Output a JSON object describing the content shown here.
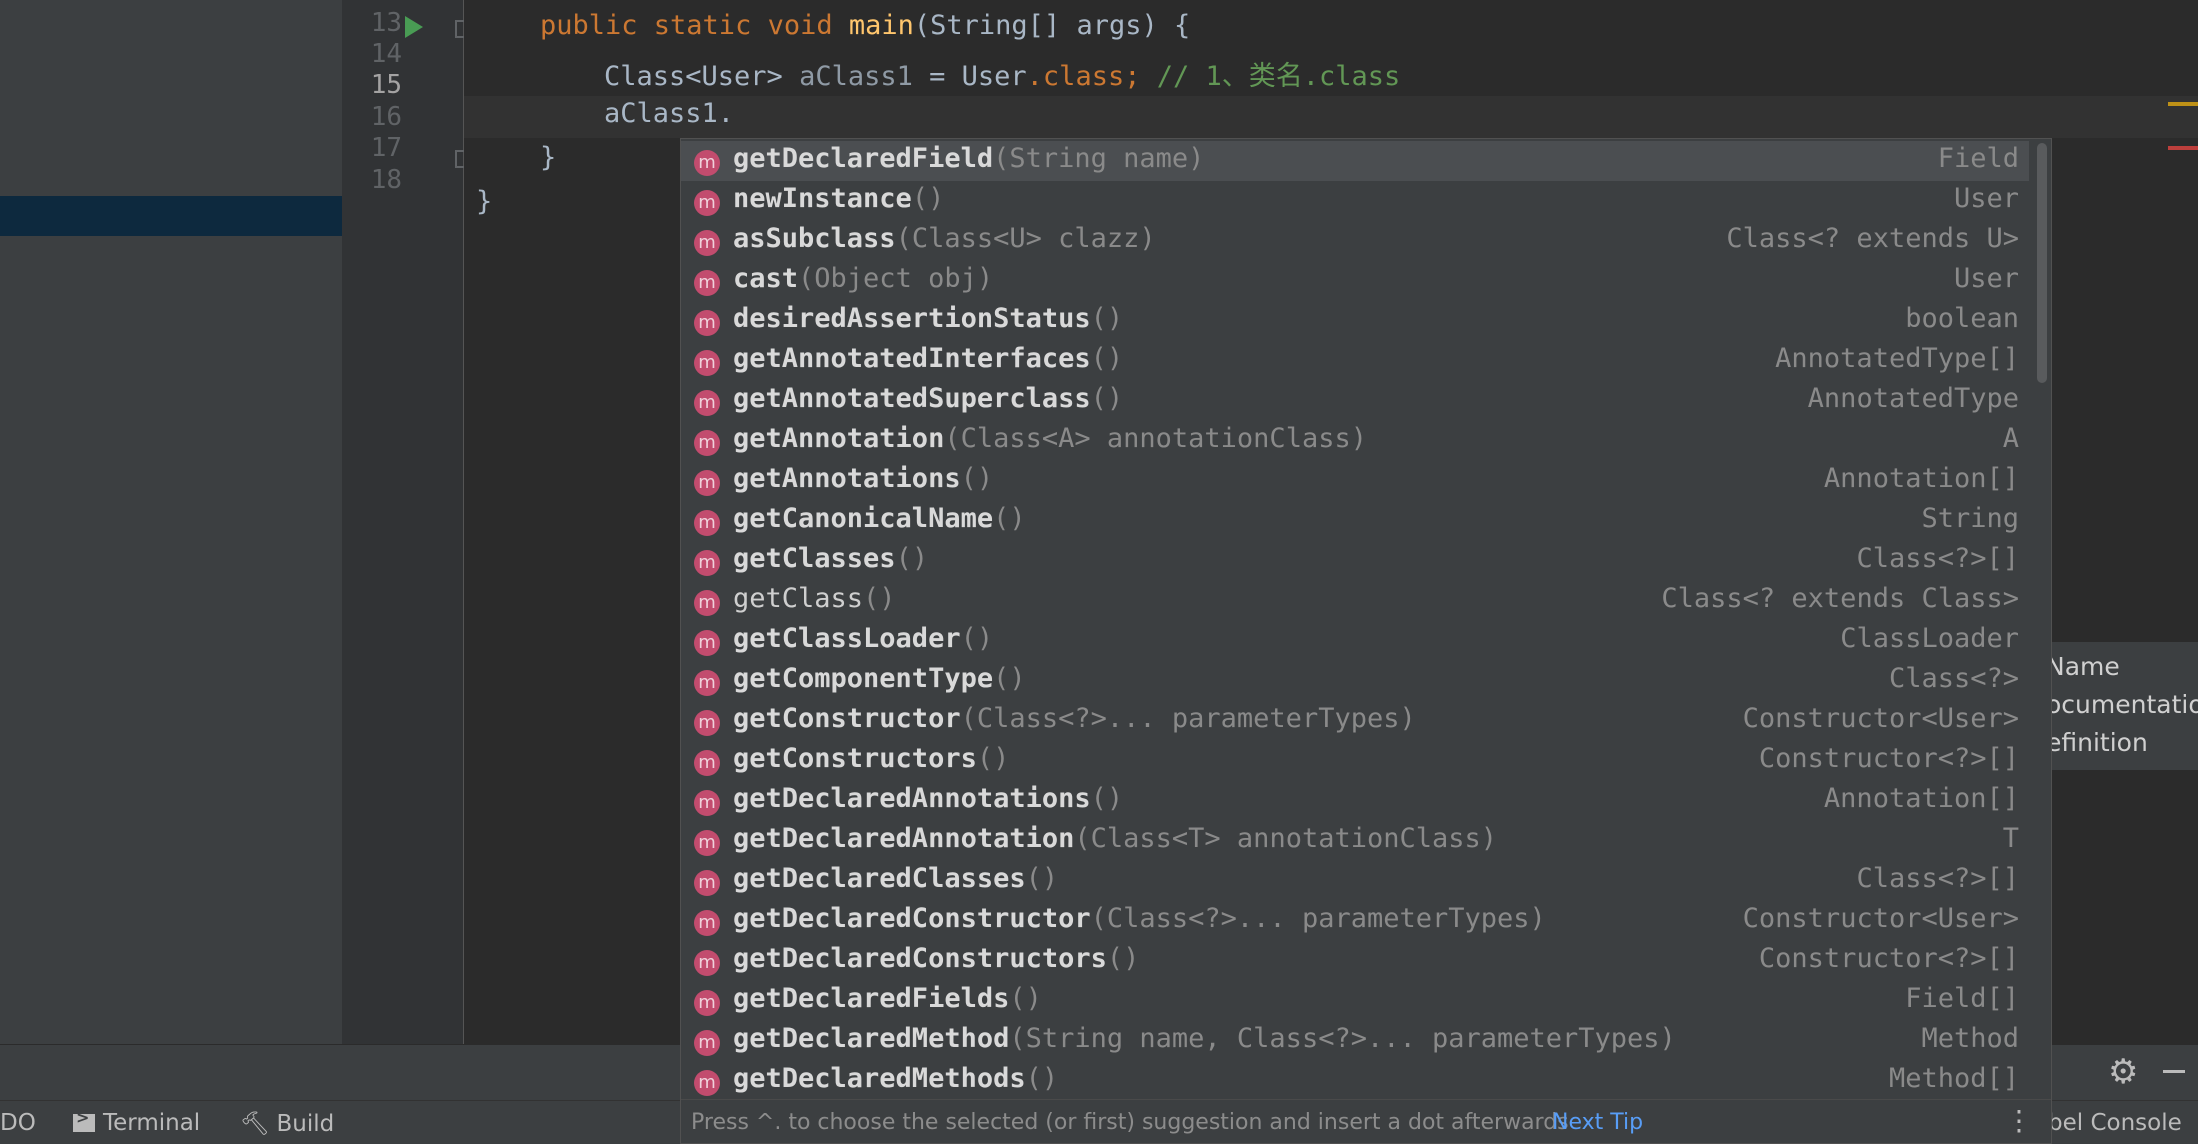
{
  "gutter": {
    "lines": [
      "13",
      "14",
      "15",
      "16",
      "17",
      "18"
    ]
  },
  "editor": {
    "line13": {
      "kw1": "public static void ",
      "fn": "main",
      "rest": "(String[] args) {"
    },
    "line14": {
      "type": "Class<User> ",
      "var": "aClass1",
      "eq": " = User",
      "kw": ".class;",
      "comment": " // 1、类名.class"
    },
    "line15": {
      "text": "aClass1."
    },
    "line16": {
      "text": "}"
    },
    "line17": {
      "text": "}"
    }
  },
  "completion": {
    "items": [
      {
        "name": "getDeclaredField",
        "params": "(String name)",
        "type": "Field"
      },
      {
        "name": "newInstance",
        "params": "()",
        "type": "User"
      },
      {
        "name": "asSubclass",
        "params": "(Class<U> clazz)",
        "type": "Class<? extends U>"
      },
      {
        "name": "cast",
        "params": "(Object obj)",
        "type": "User"
      },
      {
        "name": "desiredAssertionStatus",
        "params": "()",
        "type": "boolean"
      },
      {
        "name": "getAnnotatedInterfaces",
        "params": "()",
        "type": "AnnotatedType[]"
      },
      {
        "name": "getAnnotatedSuperclass",
        "params": "()",
        "type": "AnnotatedType"
      },
      {
        "name": "getAnnotation",
        "params": "(Class<A> annotationClass)",
        "type": "A"
      },
      {
        "name": "getAnnotations",
        "params": "()",
        "type": "Annotation[]"
      },
      {
        "name": "getCanonicalName",
        "params": "()",
        "type": "String"
      },
      {
        "name": "getClasses",
        "params": "()",
        "type": "Class<?>[]"
      },
      {
        "name": "getClass",
        "params": "()",
        "type": "Class<? extends Class>"
      },
      {
        "name": "getClassLoader",
        "params": "()",
        "type": "ClassLoader"
      },
      {
        "name": "getComponentType",
        "params": "()",
        "type": "Class<?>"
      },
      {
        "name": "getConstructor",
        "params": "(Class<?>... parameterTypes)",
        "type": "Constructor<User>"
      },
      {
        "name": "getConstructors",
        "params": "()",
        "type": "Constructor<?>[]"
      },
      {
        "name": "getDeclaredAnnotations",
        "params": "()",
        "type": "Annotation[]"
      },
      {
        "name": "getDeclaredAnnotation",
        "params": "(Class<T> annotationClass)",
        "type": "T"
      },
      {
        "name": "getDeclaredClasses",
        "params": "()",
        "type": "Class<?>[]"
      },
      {
        "name": "getDeclaredConstructor",
        "params": "(Class<?>... parameterTypes)",
        "type": "Constructor<User>"
      },
      {
        "name": "getDeclaredConstructors",
        "params": "()",
        "type": "Constructor<?>[]"
      },
      {
        "name": "getDeclaredFields",
        "params": "()",
        "type": "Field[]"
      },
      {
        "name": "getDeclaredMethod",
        "params": "(String name, Class<?>... parameterTypes)",
        "type": "Method"
      },
      {
        "name": "getDeclaredMethods",
        "params": "()",
        "type": "Method[]"
      }
    ],
    "icon_letter": "m",
    "footer_hint": "Press ^. to choose the selected (or first) suggestion and insert a dot afterwards",
    "next_tip": "Next Tip",
    "more": "⋮"
  },
  "context_menu": {
    "items": [
      "Name",
      "ocumentatio",
      "efinition"
    ]
  },
  "status_bar": {
    "todo": "DO",
    "terminal": "Terminal",
    "build": "Build",
    "console": "bel Console"
  },
  "tool_icons": {
    "gear": "⚙"
  },
  "colors": {
    "method_icon": "#c24c6e",
    "link": "#589df6",
    "keyword": "#cc7832"
  }
}
